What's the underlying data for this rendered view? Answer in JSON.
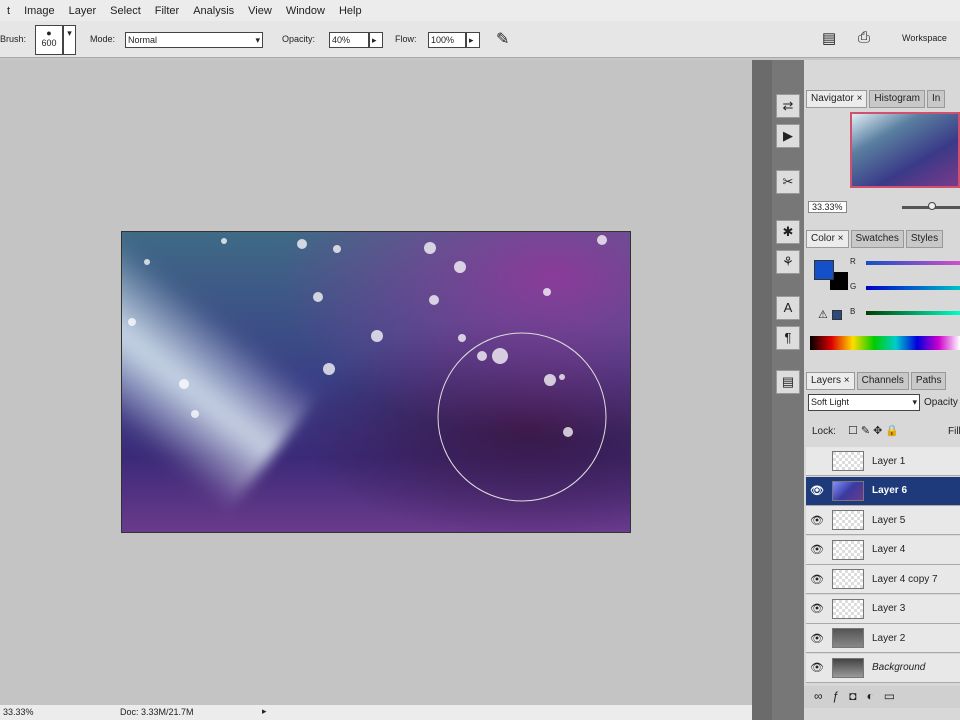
{
  "menu": [
    "t",
    "Image",
    "Layer",
    "Select",
    "Filter",
    "Analysis",
    "View",
    "Window",
    "Help"
  ],
  "options": {
    "brush_label": "Brush:",
    "brush_size": "600",
    "mode_label": "Mode:",
    "mode_value": "Normal",
    "opacity_label": "Opacity:",
    "opacity_value": "40%",
    "flow_label": "Flow:",
    "flow_value": "100%",
    "workspace": "Workspace"
  },
  "status": {
    "zoom": "33.33%",
    "doc": "Doc: 3.33M/21.7M"
  },
  "navigator": {
    "tabs": [
      "Navigator ×",
      "Histogram",
      "In"
    ],
    "zoom": "33.33%"
  },
  "color": {
    "tabs": [
      "Color ×",
      "Swatches",
      "Styles"
    ],
    "fg": "#1450c8",
    "bg": "#000000",
    "channels": [
      "R",
      "G",
      "B"
    ]
  },
  "layers": {
    "tabs": [
      "Layers ×",
      "Channels",
      "Paths"
    ],
    "blend_mode": "Soft Light",
    "opacity_label": "Opacity",
    "lock_label": "Lock:",
    "fill_label": "Fill",
    "items": [
      {
        "name": "Layer 1",
        "visible": false
      },
      {
        "name": "Layer 6",
        "visible": true,
        "selected": true
      },
      {
        "name": "Layer 5",
        "visible": true
      },
      {
        "name": "Layer 4",
        "visible": true
      },
      {
        "name": "Layer 4 copy 7",
        "visible": true
      },
      {
        "name": "Layer 3",
        "visible": true
      },
      {
        "name": "Layer 2",
        "visible": true
      },
      {
        "name": "Background",
        "visible": true
      }
    ]
  }
}
